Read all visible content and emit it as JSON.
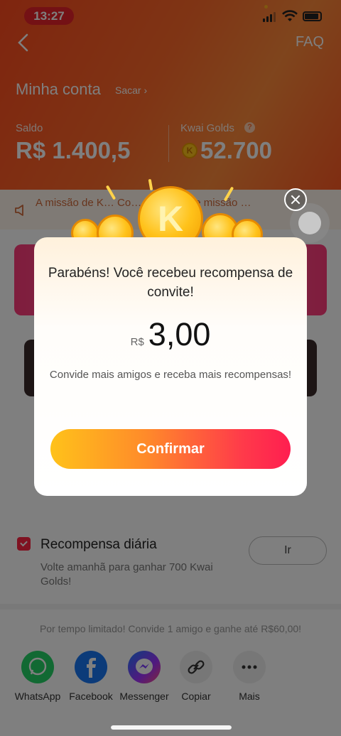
{
  "status_bar": {
    "time": "13:27"
  },
  "header": {
    "faq": "FAQ",
    "title": "Minha conta",
    "sacar": "Sacar",
    "balance_label": "Saldo",
    "balance_value": "R$ 1.400,5",
    "golds_label": "Kwai Golds",
    "golds_value": "52.700"
  },
  "notice": {
    "text": "A missão de K… Co… de valid… e missão …"
  },
  "daily": {
    "title": "Recompensa diária",
    "description": "Volte amanhã para ganhar 700 Kwai Golds!",
    "button": "Ir"
  },
  "promo_text": "Por tempo limitado! Convide 1 amigo e ganhe até R$60,00!",
  "share": [
    {
      "label": "WhatsApp",
      "icon": "whatsapp-icon",
      "color": "#25d366"
    },
    {
      "label": "Facebook",
      "icon": "facebook-icon",
      "color": "#1877f2"
    },
    {
      "label": "Messenger",
      "icon": "messenger-icon",
      "color": "#a033ff"
    },
    {
      "label": "Copiar",
      "icon": "link-icon",
      "color": "#eeeeee"
    },
    {
      "label": "Mais",
      "icon": "more-icon",
      "color": "#eeeeee"
    }
  ],
  "modal": {
    "title": "Parabéns! Você recebeu recompensa de convite!",
    "currency": "R$",
    "amount": "3,00",
    "subtitle": "Convide mais amigos e receba mais recompensas!",
    "confirm_label": "Confirmar",
    "coin_letter": "K"
  },
  "colors": {
    "header_accent": "#ff5a24",
    "confirm_start": "#ffc21a",
    "confirm_end": "#ff1e50",
    "time_pill": "#e8232a"
  }
}
